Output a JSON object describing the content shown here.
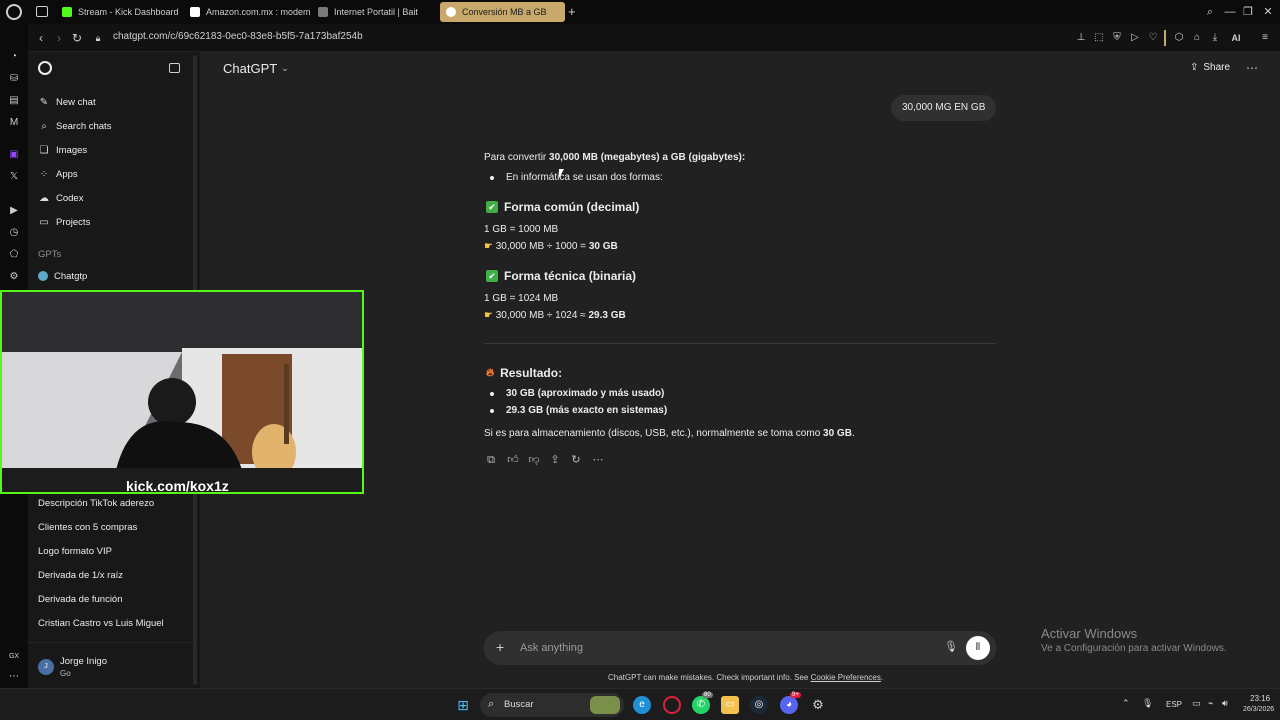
{
  "browser": {
    "tabs": [
      {
        "label": "Stream - Kick Dashboard",
        "color": "#53fc18"
      },
      {
        "label": "Amazon.com.mx : modem",
        "color": "#ffffff"
      },
      {
        "label": "Internet Portatil | Bait",
        "color": "#b0b0b0"
      },
      {
        "label": "Conversión MB a GB",
        "color": "#ffffff",
        "active": true
      }
    ],
    "new_tab": "+",
    "url": "chatgpt.com/c/69c62183-0ec0-83e8-b5f5-7a173baf254b",
    "ai_label": "AI"
  },
  "sidebar": {
    "nav": [
      {
        "label": "New chat",
        "icon": "edit-icon"
      },
      {
        "label": "Search chats",
        "icon": "search-icon"
      },
      {
        "label": "Images",
        "icon": "image-icon"
      },
      {
        "label": "Apps",
        "icon": "apps-icon"
      },
      {
        "label": "Codex",
        "icon": "codex-icon"
      },
      {
        "label": "Projects",
        "icon": "folder-icon"
      }
    ],
    "gpts_heading": "GPTs",
    "gpt_item": "Chatgtp",
    "recent": [
      "Descripción TikTok aderezo",
      "Clientes con 5 compras",
      "Logo formato VIP",
      "Derivada de 1/x raíz",
      "Derivada de función",
      "Cristian Castro vs Luis Miguel"
    ],
    "user": {
      "name": "Jorge Inigo",
      "plan": "Go",
      "initial": "J"
    }
  },
  "header": {
    "model": "ChatGPT",
    "share": "Share"
  },
  "conversation": {
    "user_message": "30,000 MG EN GB",
    "intro_plain": "Para convertir ",
    "intro_bold": "30,000 MB (megabytes) a GB (gigabytes):",
    "bullet1": "En informática se usan dos formas:",
    "section1_title": "Forma común (decimal)",
    "section1_line1": "1 GB = 1000 MB",
    "section1_line2_plain": "30,000 MB ÷ 1000 = ",
    "section1_line2_bold": "30 GB",
    "section2_title": "Forma técnica (binaria)",
    "section2_line1": "1 GB = 1024 MB",
    "section2_line2_plain": "30,000 MB ÷ 1024 ≈ ",
    "section2_line2_bold": "29.3 GB",
    "result_title": "Resultado:",
    "result1": "30 GB (aproximado y más usado)",
    "result2": "29.3 GB (más exacto en sistemas)",
    "conclusion_plain": "Si es para almacenamiento (discos, USB, etc.), normalmente se toma como ",
    "conclusion_bold": "30 GB",
    "conclusion_end": "."
  },
  "composer": {
    "placeholder": "Ask anything",
    "disclaimer_plain": "ChatGPT can make mistakes. Check important info. See ",
    "disclaimer_link": "Cookie Preferences",
    "disclaimer_end": "."
  },
  "webcam": {
    "overlay_text": "kick.com/kox1z"
  },
  "windows_watermark": {
    "title": "Activar Windows",
    "subtitle": "Ve a Configuración para activar Windows."
  },
  "taskbar": {
    "search_label": "Buscar",
    "whatsapp_badge": "80",
    "discord_badge": "9+",
    "language": "ESP",
    "time": "23:16",
    "date": "26/3/2026"
  },
  "opera_side": {
    "gx_label": "GX"
  }
}
